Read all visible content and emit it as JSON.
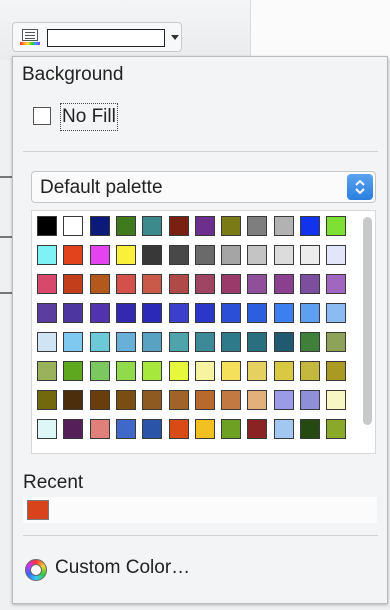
{
  "toolbar": {
    "fill_icon": "area-fill-icon",
    "dropdown_icon": "chevron-down-icon"
  },
  "panel": {
    "title": "Background",
    "no_fill": {
      "label": "No Fill",
      "checked": false
    },
    "palette_select": {
      "value": "Default palette",
      "icon": "updown-arrows-icon"
    },
    "palette_colors": [
      [
        "#000000",
        "#ffffff",
        "#0b1a7a",
        "#3f7a1c",
        "#3d8a8c",
        "#7a2010",
        "#6d2f8e",
        "#7a7a16",
        "#7e7e7e",
        "#b2b2b2",
        "#1133ee",
        "#7ee032"
      ],
      [
        "#7ff2f5",
        "#e2431d",
        "#e444f0",
        "#f8f03a",
        "#383838",
        "#484848",
        "#6a6a6a",
        "#a5a5a5",
        "#c4c4c4",
        "#dcdcdc",
        "#ececec",
        "#e3e6fb"
      ],
      [
        "#d8486a",
        "#c33f1c",
        "#b5581b",
        "#d4504a",
        "#c95a4a",
        "#b04a48",
        "#a04464",
        "#9a3a6a",
        "#8f4f9a",
        "#8a3f8f",
        "#7d4e9e",
        "#a066c0"
      ],
      [
        "#5a3d9e",
        "#4d36a0",
        "#5133b0",
        "#3328b0",
        "#2b2ab8",
        "#3b3fcc",
        "#2a37c8",
        "#2b4fd6",
        "#2b5fe0",
        "#3c7ff0",
        "#5e9ff2",
        "#8cbaf2"
      ],
      [
        "#d0e4f4",
        "#7fc8f0",
        "#6ccad8",
        "#68b0d8",
        "#5aa2c2",
        "#4fa3ab",
        "#3c8a97",
        "#2f7a8a",
        "#2a6f80",
        "#1f5a70",
        "#3f7f3a",
        "#8ea25a"
      ],
      [
        "#9ab25c",
        "#5ea820",
        "#7bc860",
        "#90da4c",
        "#a6e83c",
        "#e6f83c",
        "#f6f4a0",
        "#f4e05a",
        "#e6d060",
        "#d8c842",
        "#c4b83e",
        "#a89a22"
      ],
      [
        "#74680c",
        "#4c2e0c",
        "#6a3e0c",
        "#7a4e12",
        "#8f5a22",
        "#a0642a",
        "#b86a2e",
        "#c27a42",
        "#e2b07a",
        "#9a9ce8",
        "#8f8fd8",
        "#f8f6c2"
      ],
      [
        "#ddf6f6",
        "#55205a",
        "#e0807a",
        "#3f68c8",
        "#2a54a8",
        "#d84a16",
        "#f2c020",
        "#6ea024",
        "#8a2424",
        "#a2c8f2",
        "#244a12",
        "#8aa82a"
      ]
    ],
    "recent_label": "Recent",
    "recent_colors": [
      "#d8431c"
    ],
    "custom_color_label": "Custom Color…",
    "custom_color_icon": "color-wheel-icon"
  }
}
